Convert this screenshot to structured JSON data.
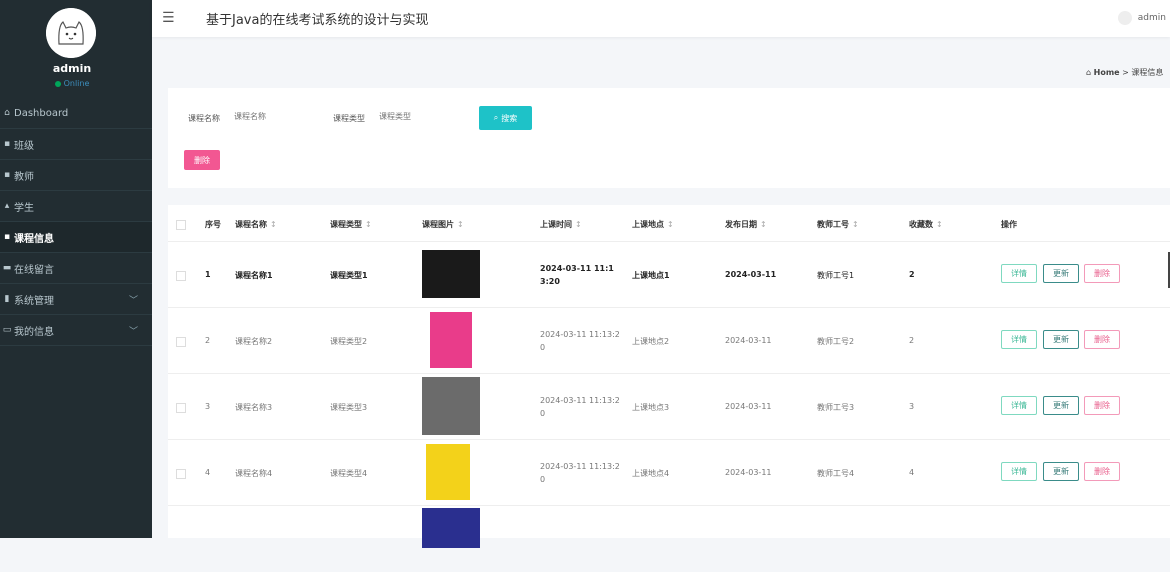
{
  "sidebar": {
    "username": "admin",
    "status": "Online",
    "items": [
      {
        "label": "Dashboard",
        "icon": "home-icon"
      },
      {
        "label": "班级",
        "icon": "grid-icon"
      },
      {
        "label": "教师",
        "icon": "grid-icon"
      },
      {
        "label": "学生",
        "icon": "graduate-icon"
      },
      {
        "label": "课程信息",
        "icon": "grid-icon",
        "active": true
      },
      {
        "label": "在线留言",
        "icon": "comment-icon"
      },
      {
        "label": "系统管理",
        "icon": "bar-chart-icon",
        "expandable": true
      },
      {
        "label": "我的信息",
        "icon": "id-card-icon",
        "expandable": true
      }
    ]
  },
  "header": {
    "title": "基于Java的在线考试系统的设计与实现",
    "user": "admin"
  },
  "breadcrumb": {
    "home": "Home",
    "separator": ">",
    "current": "课程信息"
  },
  "search": {
    "course_name_label": "课程名称",
    "course_name_placeholder": "课程名称",
    "course_type_label": "课程类型",
    "course_type_placeholder": "课程类型",
    "search_button": "搜索",
    "delete_button": "删除"
  },
  "table": {
    "headers": {
      "index": "序号",
      "name": "课程名称",
      "type": "课程类型",
      "image": "课程图片",
      "time": "上课时间",
      "place": "上课地点",
      "date": "发布日期",
      "teacher": "教师工号",
      "fav": "收藏数",
      "ops": "操作"
    },
    "sort_glyph": "↕",
    "actions": {
      "detail": "详情",
      "update": "更新",
      "delete": "删除"
    },
    "rows": [
      {
        "index": "1",
        "name": "课程名称1",
        "type": "课程类型1",
        "time": "2024-03-11 11:13:20",
        "place": "上课地点1",
        "date": "2024-03-11",
        "teacher": "教师工号1",
        "fav": "2",
        "thumb_color": "#1a1a1a"
      },
      {
        "index": "2",
        "name": "课程名称2",
        "type": "课程类型2",
        "time": "2024-03-11 11:13:20",
        "place": "上课地点2",
        "date": "2024-03-11",
        "teacher": "教师工号2",
        "fav": "2",
        "thumb_color": "#e93c8a"
      },
      {
        "index": "3",
        "name": "课程名称3",
        "type": "课程类型3",
        "time": "2024-03-11 11:13:20",
        "place": "上课地点3",
        "date": "2024-03-11",
        "teacher": "教师工号3",
        "fav": "3",
        "thumb_color": "#6b6b6b"
      },
      {
        "index": "4",
        "name": "课程名称4",
        "type": "课程类型4",
        "time": "2024-03-11 11:13:20",
        "place": "上课地点4",
        "date": "2024-03-11",
        "teacher": "教师工号4",
        "fav": "4",
        "thumb_color": "#f3d21a"
      }
    ]
  },
  "colors": {
    "sidebar": "#222d32",
    "search_btn": "#1ec2c8",
    "delete_btn": "#f25792"
  }
}
